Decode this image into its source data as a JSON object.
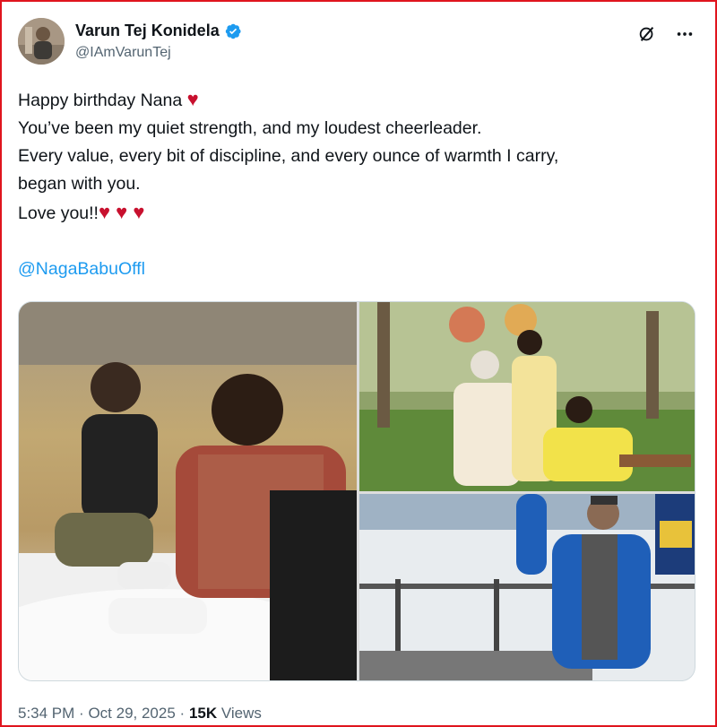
{
  "author": {
    "name": "Varun Tej Konidela",
    "handle": "@IAmVarunTej",
    "verified": true,
    "avatar_icon": "avatar-photo"
  },
  "tweet": {
    "lines": [
      "Happy birthday Nana",
      "You’ve been my quiet strength, and my loudest cheerleader.",
      "Every value, every bit of discipline, and every ounce of warmth I carry,",
      "began with you.",
      "Love you!!"
    ],
    "hearts_line1": "♥",
    "hearts_line5": "♥ ♥ ♥",
    "mention": "@NagaBabuOffl"
  },
  "media": {
    "photos": [
      {
        "name": "photo-father-son-snow"
      },
      {
        "name": "photo-family-garden"
      },
      {
        "name": "photo-man-mountain-snow"
      }
    ]
  },
  "footer": {
    "time": "5:34 PM",
    "date": "Oct 29, 2025",
    "separator": "·",
    "views_count": "15K",
    "views_label": "Views"
  },
  "colors": {
    "accent": "#1d9bf0",
    "border": "#e0141e",
    "heart": "#c8102e"
  }
}
